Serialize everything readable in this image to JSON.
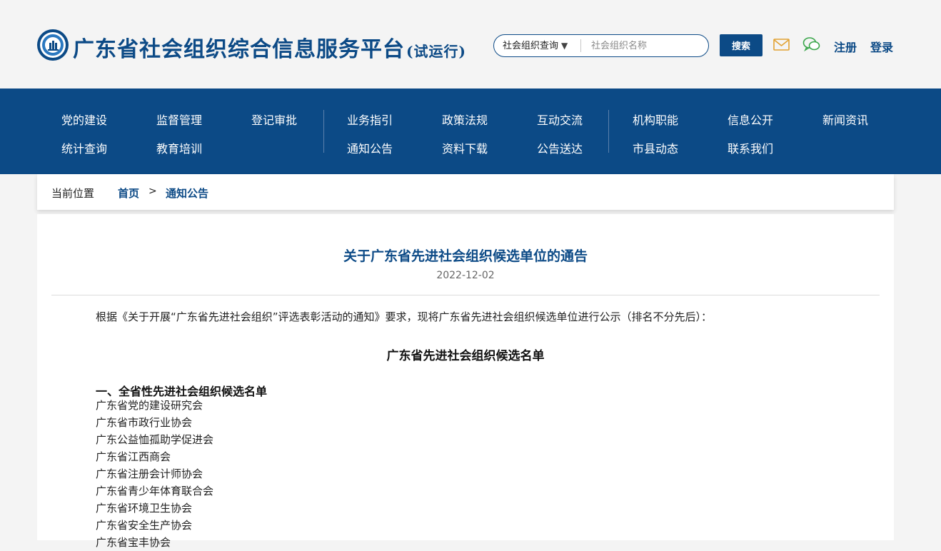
{
  "header": {
    "site_title": "广东省社会组织综合信息服务平台",
    "site_title_suffix": "(试运行)",
    "search": {
      "select_value": "社会组织查询",
      "placeholder": "社会组织名称",
      "button_label": "搜索"
    },
    "register_label": "注册",
    "login_label": "登录",
    "colors": {
      "brand": "#0c4a86",
      "mail_icon": "#e2a232",
      "chat_icon": "#3aa64a"
    }
  },
  "nav": {
    "items": [
      "党的建设",
      "监督管理",
      "登记审批",
      "业务指引",
      "政策法规",
      "互动交流",
      "机构职能",
      "信息公开",
      "新闻资讯",
      "统计查询",
      "教育培训",
      "通知公告",
      "资料下载",
      "公告送达",
      "市县动态",
      "联系我们"
    ]
  },
  "breadcrumb": {
    "label": "当前位置",
    "home": "首页",
    "separator": ">",
    "current": "通知公告"
  },
  "article": {
    "title": "关于广东省先进社会组织候选单位的通告",
    "date": "2022-12-02",
    "intro": "根据《关于开展“广东省先进社会组织”评选表彰活动的通知》要求，现将广东省先进社会组织候选单位进行公示（排名不分先后）：",
    "list_title": "广东省先进社会组织候选名单",
    "section_1": {
      "heading": "一、全省性先进社会组织候选名单",
      "orgs": [
        "广东省党的建设研究会",
        "广东省市政行业协会",
        "广东公益恤孤助学促进会",
        "广东省江西商会",
        "广东省注册会计师协会",
        "广东省青少年体育联合会",
        "广东省环境卫生协会",
        "广东省安全生产协会",
        "广东省宝丰协会"
      ]
    }
  }
}
